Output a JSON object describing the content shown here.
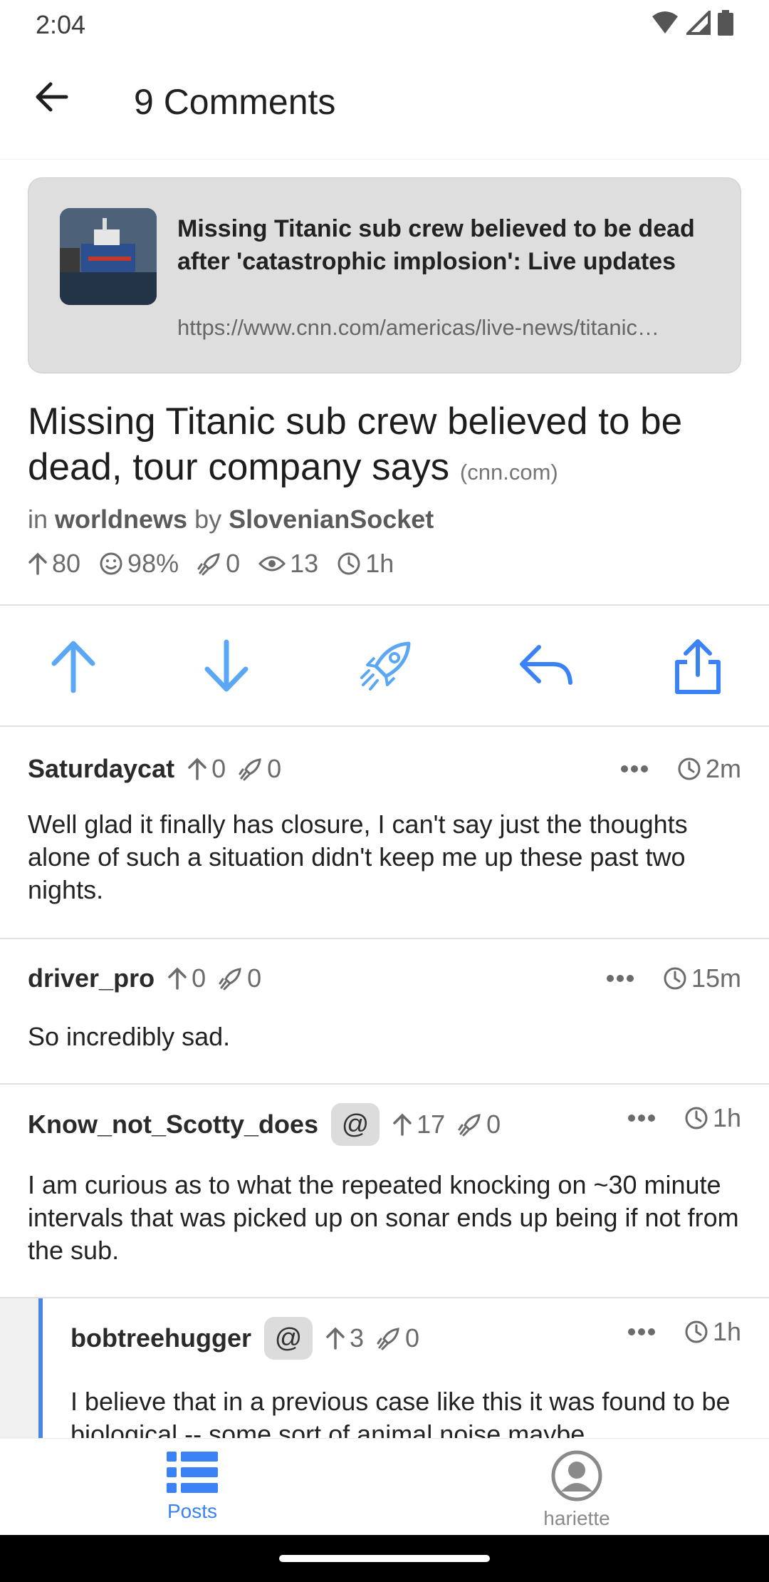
{
  "status_bar": {
    "time": "2:04"
  },
  "app_bar": {
    "title": "9 Comments"
  },
  "link_card": {
    "title": "Missing Titanic sub crew believed to be dead after 'catastrophic implosion': Live updates",
    "url": "https://www.cnn.com/americas/live-news/titanic…"
  },
  "post": {
    "title": "Missing Titanic sub crew believed to be dead, tour company says",
    "domain": "(cnn.com)",
    "in_label": "in",
    "community": "worldnews",
    "by_label": "by",
    "author": "SlovenianSocket",
    "stats": {
      "score": "80",
      "upvote_pct": "98%",
      "boosts": "0",
      "views": "13",
      "age": "1h"
    }
  },
  "comments": [
    {
      "user": "Saturdaycat",
      "score": "0",
      "boosts": "0",
      "age": "2m",
      "body": "Well glad it finally has closure, I can't say just the thoughts alone of such a situation didn't keep me up these past two nights."
    },
    {
      "user": "driver_pro",
      "score": "0",
      "boosts": "0",
      "age": "15m",
      "body": "So incredibly sad."
    },
    {
      "user": "Know_not_Scotty_does",
      "mention": "@",
      "score": "17",
      "boosts": "0",
      "age": "1h",
      "body": "I am curious as to what the repeated knocking on ~30 minute intervals that was picked up on sonar ends up being if not from the sub."
    },
    {
      "user": "bobtreehugger",
      "mention": "@",
      "score": "3",
      "boosts": "0",
      "age": "1h",
      "body": "I believe that in a previous case like this it was found to be biological -- some sort of animal noise maybe"
    }
  ],
  "bottom_nav": {
    "posts_label": "Posts",
    "profile_label": "hariette"
  },
  "colors": {
    "accent": "#3b82f6",
    "action_icon": "#5aa7f5",
    "nested_bar": "#4a86e8"
  }
}
